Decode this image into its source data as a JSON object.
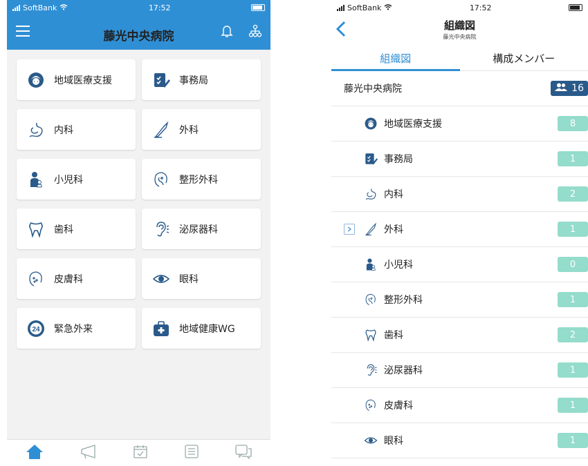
{
  "left": {
    "status": {
      "carrier": "SoftBank",
      "time": "17:52"
    },
    "header": {
      "title": "藤光中央病院",
      "menu_icon": "menu-icon",
      "bell_icon": "bell-icon",
      "org_icon": "org-chart-icon"
    },
    "tiles": [
      {
        "label": "地域医療支援",
        "icon": "nurse-icon"
      },
      {
        "label": "事務局",
        "icon": "checklist-icon"
      },
      {
        "label": "内科",
        "icon": "stomach-icon"
      },
      {
        "label": "外科",
        "icon": "scalpel-icon"
      },
      {
        "label": "小児科",
        "icon": "child-icon"
      },
      {
        "label": "整形外科",
        "icon": "face-bone-icon"
      },
      {
        "label": "歯科",
        "icon": "tooth-icon"
      },
      {
        "label": "泌尿器科",
        "icon": "ear-icon"
      },
      {
        "label": "皮膚科",
        "icon": "skin-icon"
      },
      {
        "label": "眼科",
        "icon": "eye-icon"
      },
      {
        "label": "緊急外来",
        "icon": "emergency-24-icon"
      },
      {
        "label": "地域健康WG",
        "icon": "medical-kit-icon"
      }
    ],
    "bottom_nav": [
      "home-icon",
      "megaphone-icon",
      "calendar-icon",
      "list-icon",
      "chat-icon"
    ]
  },
  "right": {
    "status": {
      "carrier": "SoftBank",
      "time": "17:52"
    },
    "header": {
      "title": "組織図",
      "subtitle": "藤光中央病院",
      "back_icon": "back-icon"
    },
    "tabs": [
      {
        "label": "組織図"
      },
      {
        "label": "構成メンバー"
      }
    ],
    "root": {
      "label": "藤光中央病院",
      "count": "16",
      "icon": "people-icon"
    },
    "rows": [
      {
        "label": "地域医療支援",
        "count": "8",
        "icon": "nurse-icon"
      },
      {
        "label": "事務局",
        "count": "1",
        "icon": "checklist-icon"
      },
      {
        "label": "内科",
        "count": "2",
        "icon": "stomach-icon"
      },
      {
        "label": "外科",
        "count": "1",
        "icon": "scalpel-icon",
        "expandable": true
      },
      {
        "label": "小児科",
        "count": "0",
        "icon": "child-icon"
      },
      {
        "label": "整形外科",
        "count": "1",
        "icon": "face-bone-icon"
      },
      {
        "label": "歯科",
        "count": "2",
        "icon": "tooth-icon"
      },
      {
        "label": "泌尿器科",
        "count": "1",
        "icon": "ear-icon"
      },
      {
        "label": "皮膚科",
        "count": "1",
        "icon": "skin-icon"
      },
      {
        "label": "眼科",
        "count": "1",
        "icon": "eye-icon"
      }
    ]
  },
  "colors": {
    "primary": "#2f8fd5",
    "badge_dark": "#2a5a8a",
    "count_badge": "#94dccb"
  }
}
